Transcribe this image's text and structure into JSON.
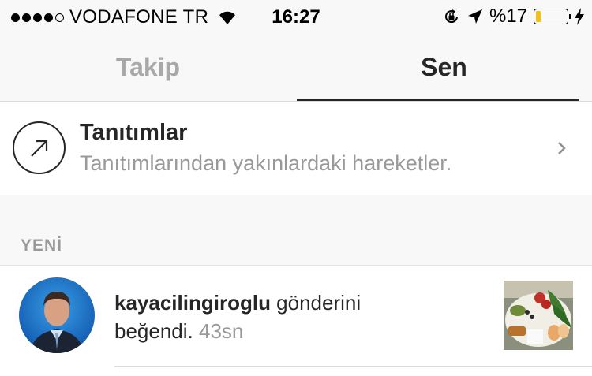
{
  "status_bar": {
    "carrier": "VODAFONE TR",
    "time": "16:27",
    "battery_percent": "%17",
    "battery_level": 0.17,
    "signal_dots_filled": 4,
    "signal_dots_total": 5,
    "icons": [
      "wifi-icon",
      "orientation-lock-icon",
      "location-arrow-icon",
      "battery-icon",
      "charging-bolt-icon"
    ]
  },
  "tabs": [
    {
      "label": "Takip",
      "active": false
    },
    {
      "label": "Sen",
      "active": true
    }
  ],
  "promotions": {
    "title": "Tanıtımlar",
    "subtitle": "Tanıtımlarından yakınlardaki hareketler.",
    "icon": "arrow-up-right-circle-icon",
    "chevron_icon": "chevron-right-icon"
  },
  "section": {
    "title": "YENİ"
  },
  "notification": {
    "username": "kayacilingiroglu",
    "action_part1": " gönderini",
    "action_part2": "beğendi.",
    "time": "43sn"
  },
  "colors": {
    "text_primary": "#262626",
    "text_secondary": "#999999",
    "tab_inactive": "#a8a8a8",
    "bar_background": "#f8f8f8",
    "battery_fill": "#f4c20d"
  }
}
